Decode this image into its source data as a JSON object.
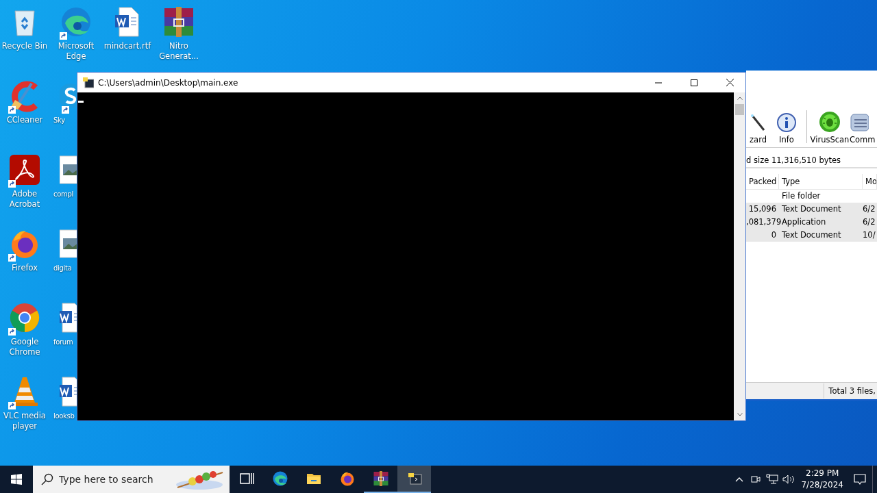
{
  "desktop": {
    "columns": [
      [
        {
          "label": "Recycle Bin",
          "kind": "recycle",
          "shortcut": false
        },
        {
          "label": "CCleaner",
          "kind": "ccleaner",
          "shortcut": true
        },
        {
          "label": "Adobe Acrobat",
          "kind": "acrobat",
          "shortcut": true
        },
        {
          "label": "Firefox",
          "kind": "firefox",
          "shortcut": true
        },
        {
          "label": "Google Chrome",
          "kind": "chrome",
          "shortcut": true
        },
        {
          "label": "VLC media player",
          "kind": "vlc",
          "shortcut": true
        }
      ],
      [
        {
          "label": "Microsoft Edge",
          "kind": "edge",
          "shortcut": true
        },
        {
          "label": "Sky",
          "kind": "skype",
          "shortcut": true
        },
        {
          "label": "compl",
          "kind": "image",
          "shortcut": false
        },
        {
          "label": "digita",
          "kind": "image",
          "shortcut": false
        },
        {
          "label": "forum",
          "kind": "word",
          "shortcut": false
        },
        {
          "label": "looksb",
          "kind": "word",
          "shortcut": false
        }
      ],
      [
        {
          "label": "mindcart.rtf",
          "kind": "word",
          "shortcut": false
        }
      ],
      [
        {
          "label": "Nitro Generat...",
          "kind": "winrar",
          "shortcut": false
        }
      ]
    ]
  },
  "archive_window": {
    "toolbar": [
      {
        "label": "zard",
        "kind": "wizard"
      },
      {
        "label": "Info",
        "kind": "info"
      },
      {
        "label": "VirusScan",
        "kind": "virus"
      },
      {
        "label": "Comm",
        "kind": "comment"
      }
    ],
    "summary": "d size 11,316,510 bytes",
    "columns": [
      "Packed",
      "Type",
      "Mo"
    ],
    "rows": [
      {
        "packed": "",
        "type": "File folder",
        "modified": "",
        "selected": false
      },
      {
        "packed": "15,096",
        "type": "Text Document",
        "modified": "6/2",
        "selected": true
      },
      {
        "packed": ",081,379",
        "type": "Application",
        "modified": "6/2",
        "selected": true
      },
      {
        "packed": "0",
        "type": "Text Document",
        "modified": "10/",
        "selected": true
      }
    ],
    "status": "Total 3 files,"
  },
  "console_window": {
    "title": "C:\\Users\\admin\\Desktop\\main.exe"
  },
  "taskbar": {
    "search": {
      "placeholder": "Type here to search"
    },
    "apps": [
      {
        "kind": "taskview",
        "running": false,
        "selected": false
      },
      {
        "kind": "edge",
        "running": false,
        "selected": false
      },
      {
        "kind": "folder",
        "running": false,
        "selected": false
      },
      {
        "kind": "firefox",
        "running": false,
        "selected": false
      },
      {
        "kind": "winrar",
        "running": true,
        "selected": false
      },
      {
        "kind": "python",
        "running": true,
        "selected": true
      }
    ],
    "time": "2:29 PM",
    "date": "7/28/2024"
  }
}
